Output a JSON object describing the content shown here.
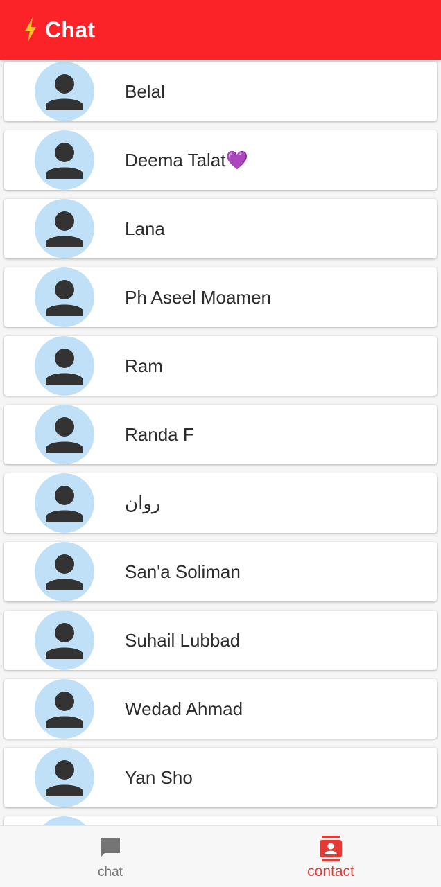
{
  "appbar": {
    "title": "Chat",
    "icon": "lightning-bolt-icon",
    "background_color": "#fb2228",
    "icon_color": "#f9c12a"
  },
  "contacts": [
    {
      "name": "Belal"
    },
    {
      "name": "Deema Talat💜"
    },
    {
      "name": "Lana"
    },
    {
      "name": "Ph Aseel Moamen"
    },
    {
      "name": "Ram"
    },
    {
      "name": "Randa F"
    },
    {
      "name": "روان"
    },
    {
      "name": "San'a Soliman"
    },
    {
      "name": "Suhail Lubbad"
    },
    {
      "name": "Wedad Ahmad"
    },
    {
      "name": "Yan Sho"
    },
    {
      "name": ""
    }
  ],
  "avatar": {
    "icon": "person-icon",
    "background_color": "#bfe0f7",
    "icon_color": "#333333"
  },
  "bottom_nav": {
    "items": [
      {
        "label": "chat",
        "icon": "chat-bubble-icon",
        "active": false,
        "color": "#757575"
      },
      {
        "label": "contact",
        "icon": "contact-card-icon",
        "active": true,
        "color": "#e53935"
      }
    ]
  }
}
